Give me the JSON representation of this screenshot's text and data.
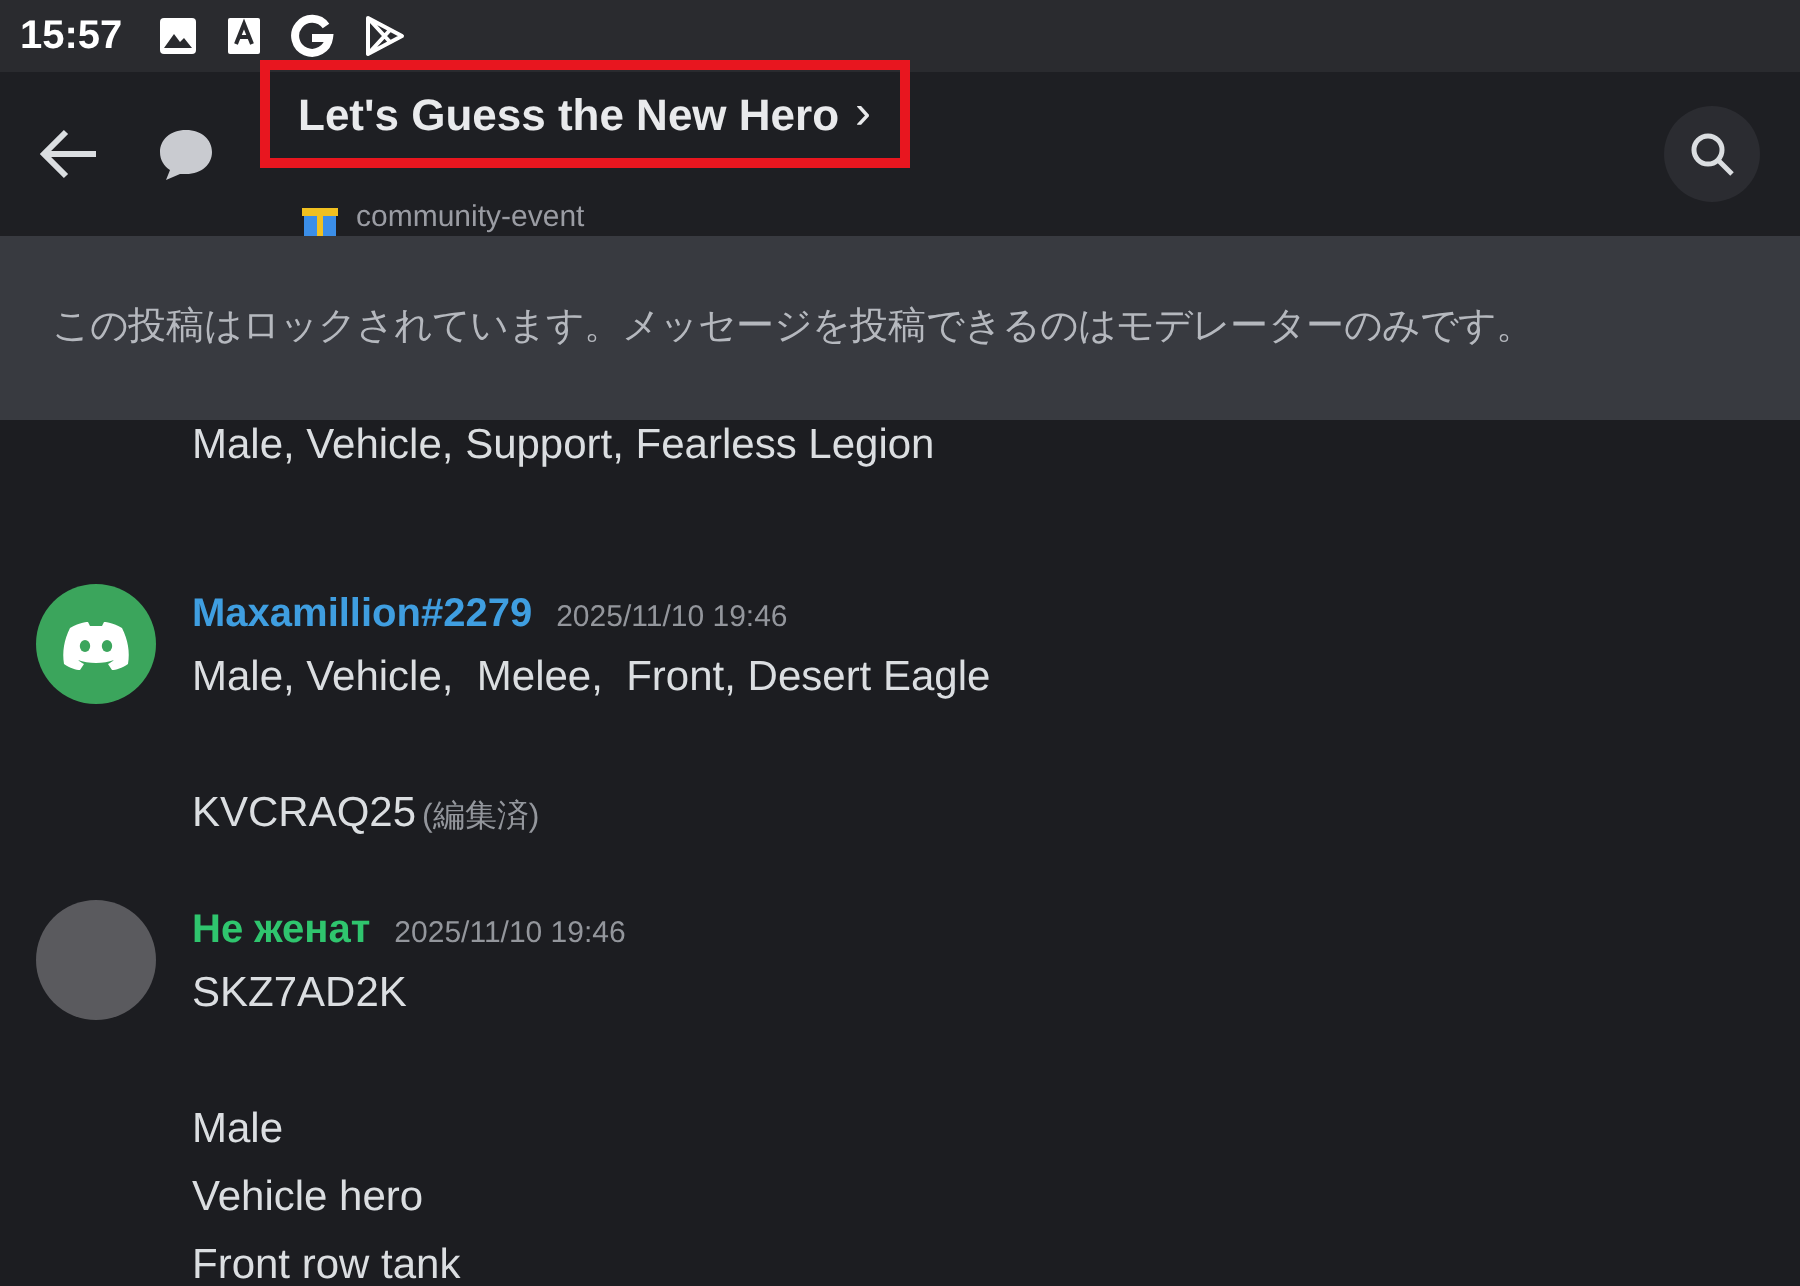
{
  "status_bar": {
    "time": "15:57"
  },
  "header": {
    "title": "Let's Guess the New Hero",
    "chevron": "›",
    "subtitle": "community-event",
    "highlighted": true
  },
  "lock_banner": "この投稿はロックされています。メッセージを投稿できるのはモデレーターのみです。",
  "messages": [
    {
      "kind": "continuation",
      "paragraphs": [
        [
          "Male, Vehicle, Support, Fearless Legion"
        ]
      ]
    },
    {
      "kind": "full",
      "avatar": {
        "kind": "logo"
      },
      "author": "Maxamillion#2279",
      "color": "#3f9ee0",
      "timestamp": "2025/11/10 19:46",
      "paragraphs": [
        [
          "Male, Vehicle,  Melee,  Front, Desert Eagle"
        ],
        [
          "KVCRAQ25"
        ]
      ],
      "edited": "(編集済)"
    },
    {
      "kind": "full",
      "avatar": {
        "kind": "photo"
      },
      "author": "Не женат",
      "color": "#2fc56e",
      "timestamp": "2025/11/10 19:46",
      "paragraphs": [
        [
          "SKZ7AD2K"
        ],
        [
          "Male",
          "Vehicle hero",
          "Front row tank"
        ]
      ]
    }
  ]
}
